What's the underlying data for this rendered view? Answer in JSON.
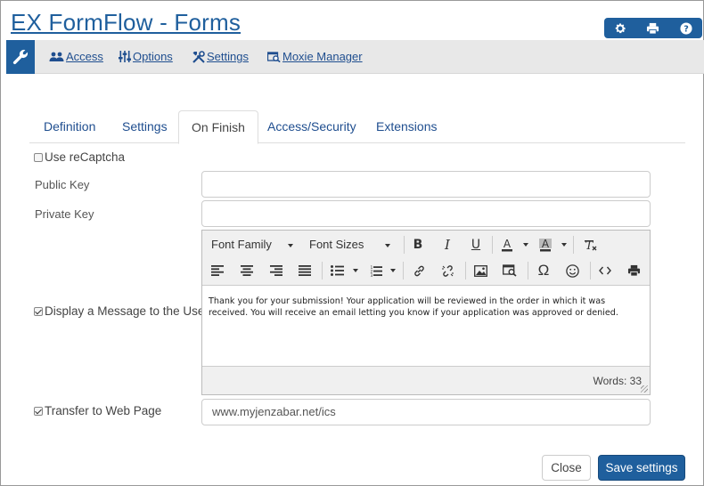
{
  "app": {
    "title": "EX FormFlow - Forms"
  },
  "header_icons": [
    "gear-icon",
    "print-icon",
    "help-icon"
  ],
  "nav": {
    "items": [
      {
        "label": "Access",
        "icon": "users-icon"
      },
      {
        "label": "Options",
        "icon": "sliders-icon"
      },
      {
        "label": "Settings",
        "icon": "tools-icon"
      },
      {
        "label": "Moxie Manager",
        "icon": "moxie-icon"
      }
    ]
  },
  "tabs": [
    {
      "label": "Definition",
      "active": false
    },
    {
      "label": "Settings",
      "active": false
    },
    {
      "label": "On Finish",
      "active": true
    },
    {
      "label": "Access/Security",
      "active": false
    },
    {
      "label": "Extensions",
      "active": false
    }
  ],
  "form": {
    "recaptcha": {
      "label": "Use reCaptcha",
      "checked": false
    },
    "public_key": {
      "label": "Public Key",
      "value": ""
    },
    "private_key": {
      "label": "Private Key",
      "value": ""
    },
    "display_message": {
      "label": "Display a Message to the User",
      "checked": true
    },
    "transfer": {
      "label": "Transfer to Web Page",
      "checked": true,
      "value": "www.myjenzabar.net/ics"
    }
  },
  "editor": {
    "font_family_label": "Font Family",
    "font_sizes_label": "Font Sizes",
    "omega_symbol": "Ω",
    "content": "Thank you for your submission! Your application will be reviewed in the order in which it was received. You will receive an email letting you know if your application was approved or denied.",
    "words_label": "Words:",
    "words_count": "33"
  },
  "buttons": {
    "close": "Close",
    "save": "Save settings"
  },
  "colors": {
    "primary": "#1f5f9d",
    "link": "#1f4e8f",
    "nav_bg": "#e8e8e8"
  }
}
